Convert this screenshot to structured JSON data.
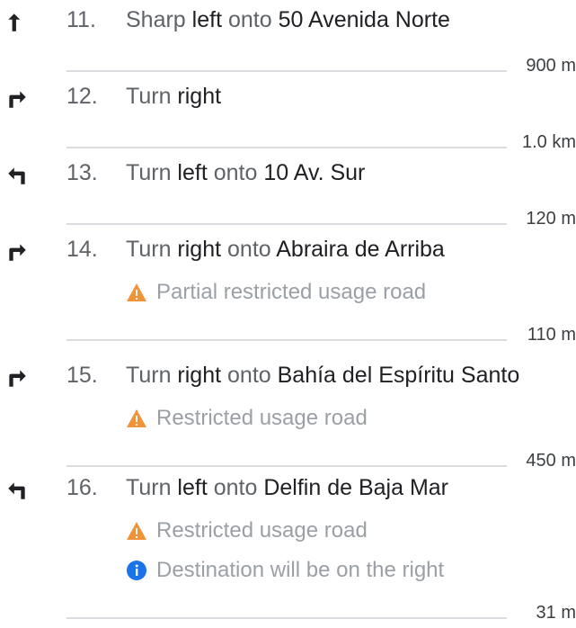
{
  "steps": [
    {
      "number": "11.",
      "icon": "sharp-left-arrow-icon",
      "parts": [
        {
          "text": "Sharp ",
          "bold": false
        },
        {
          "text": "left",
          "bold": true
        },
        {
          "text": " onto ",
          "bold": false
        },
        {
          "text": "50 Avenida Norte",
          "bold": true
        }
      ],
      "notices": [],
      "distance": "900 m"
    },
    {
      "number": "12.",
      "icon": "turn-right-arrow-icon",
      "parts": [
        {
          "text": "Turn ",
          "bold": false
        },
        {
          "text": "right",
          "bold": true
        }
      ],
      "notices": [],
      "distance": "1.0 km"
    },
    {
      "number": "13.",
      "icon": "turn-left-arrow-icon",
      "parts": [
        {
          "text": "Turn ",
          "bold": false
        },
        {
          "text": "left",
          "bold": true
        },
        {
          "text": " onto ",
          "bold": false
        },
        {
          "text": "10 Av. Sur",
          "bold": true
        }
      ],
      "notices": [],
      "distance": "120 m"
    },
    {
      "number": "14.",
      "icon": "turn-right-arrow-icon",
      "parts": [
        {
          "text": "Turn ",
          "bold": false
        },
        {
          "text": "right",
          "bold": true
        },
        {
          "text": " onto ",
          "bold": false
        },
        {
          "text": "Abraira de Arriba",
          "bold": true
        }
      ],
      "notices": [
        {
          "icon": "warning-icon",
          "text": "Partial restricted usage road"
        }
      ],
      "distance": "110 m"
    },
    {
      "number": "15.",
      "icon": "turn-right-arrow-icon",
      "parts": [
        {
          "text": "Turn ",
          "bold": false
        },
        {
          "text": "right",
          "bold": true
        },
        {
          "text": " onto ",
          "bold": false
        },
        {
          "text": "Bahía del Espíritu Santo",
          "bold": true
        }
      ],
      "notices": [
        {
          "icon": "warning-icon",
          "text": "Restricted usage road"
        }
      ],
      "distance": "450 m"
    },
    {
      "number": "16.",
      "icon": "turn-left-arrow-icon",
      "parts": [
        {
          "text": "Turn ",
          "bold": false
        },
        {
          "text": "left",
          "bold": true
        },
        {
          "text": " onto ",
          "bold": false
        },
        {
          "text": "Delfin de Baja Mar",
          "bold": true
        }
      ],
      "notices": [
        {
          "icon": "warning-icon",
          "text": "Restricted usage road"
        },
        {
          "icon": "info-icon",
          "text": "Destination will be on the right"
        }
      ],
      "distance": "31 m"
    }
  ],
  "colors": {
    "warning": "#f29339",
    "info": "#1a73e8",
    "icon": "#202124"
  }
}
